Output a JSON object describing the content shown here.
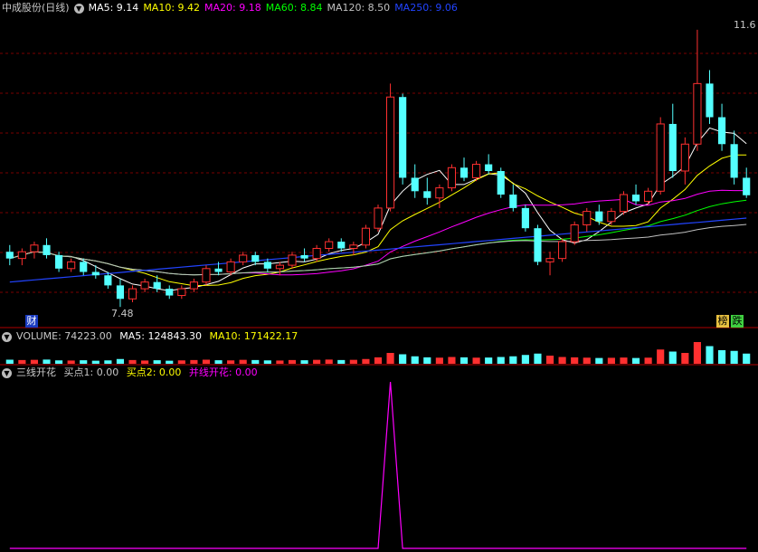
{
  "price_panel": {
    "title": "中成股份(日线)",
    "ma_labels": [
      {
        "name": "MA5",
        "value": "9.14",
        "color": "#ffffff"
      },
      {
        "name": "MA10",
        "value": "9.42",
        "color": "#ffff00"
      },
      {
        "name": "MA20",
        "value": "9.18",
        "color": "#ff00ff"
      },
      {
        "name": "MA60",
        "value": "8.84",
        "color": "#00ff00"
      },
      {
        "name": "MA120",
        "value": "8.50",
        "color": "#c0c0c0"
      },
      {
        "name": "MA250",
        "value": "9.06",
        "color": "#2244ff"
      }
    ],
    "high_label": "11.6",
    "low_label": "7.48",
    "badge_cai": "财",
    "badge_bang": "榜",
    "badge_die": "跌"
  },
  "volume_panel": {
    "title": "VOLUME",
    "value": "74223.00",
    "ma5_label": "MA5",
    "ma5_value": "124843.30",
    "ma10_label": "MA10",
    "ma10_value": "171422.17"
  },
  "indicator_panel": {
    "title": "三线开花",
    "buy1_label": "买点1",
    "buy1_value": "0.00",
    "buy2_label": "买点2",
    "buy2_value": "0.00",
    "bingxian_label": "并线开花",
    "bingxian_value": "0.00"
  },
  "colors": {
    "up": "#ff3030",
    "down": "#54ffff",
    "ma5": "#ffffff",
    "ma10": "#ffff00",
    "ma20": "#ff00ff",
    "ma60": "#00ff00",
    "ma120": "#c0c0c0",
    "ma250": "#2244ff",
    "grid": "#7a0000",
    "separator": "#b00000"
  },
  "chart_data": [
    {
      "type": "candlestick",
      "title": "中成股份(日线)",
      "ylim": [
        7.2,
        11.8
      ],
      "candles": [
        [
          8.3,
          8.4,
          8.1,
          8.2
        ],
        [
          8.2,
          8.35,
          8.1,
          8.3
        ],
        [
          8.3,
          8.45,
          8.2,
          8.4
        ],
        [
          8.4,
          8.5,
          8.2,
          8.25
        ],
        [
          8.25,
          8.3,
          8.0,
          8.05
        ],
        [
          8.05,
          8.2,
          8.0,
          8.15
        ],
        [
          8.15,
          8.2,
          7.95,
          8.0
        ],
        [
          8.0,
          8.1,
          7.9,
          7.95
        ],
        [
          7.95,
          8.0,
          7.75,
          7.8
        ],
        [
          7.8,
          7.9,
          7.48,
          7.6
        ],
        [
          7.6,
          7.8,
          7.55,
          7.75
        ],
        [
          7.75,
          7.9,
          7.7,
          7.85
        ],
        [
          7.85,
          7.95,
          7.7,
          7.75
        ],
        [
          7.75,
          7.8,
          7.6,
          7.65
        ],
        [
          7.65,
          7.8,
          7.6,
          7.75
        ],
        [
          7.75,
          7.9,
          7.7,
          7.85
        ],
        [
          7.85,
          8.1,
          7.8,
          8.05
        ],
        [
          8.05,
          8.15,
          7.95,
          8.0
        ],
        [
          8.0,
          8.2,
          7.95,
          8.15
        ],
        [
          8.15,
          8.3,
          8.1,
          8.25
        ],
        [
          8.25,
          8.3,
          8.1,
          8.15
        ],
        [
          8.15,
          8.2,
          8.0,
          8.05
        ],
        [
          8.05,
          8.15,
          7.95,
          8.1
        ],
        [
          8.1,
          8.3,
          8.05,
          8.25
        ],
        [
          8.25,
          8.35,
          8.15,
          8.2
        ],
        [
          8.2,
          8.4,
          8.15,
          8.35
        ],
        [
          8.35,
          8.5,
          8.3,
          8.45
        ],
        [
          8.45,
          8.5,
          8.3,
          8.35
        ],
        [
          8.35,
          8.45,
          8.25,
          8.4
        ],
        [
          8.4,
          8.7,
          8.35,
          8.65
        ],
        [
          8.65,
          9.0,
          8.6,
          8.95
        ],
        [
          8.95,
          10.8,
          8.9,
          10.6
        ],
        [
          10.6,
          10.65,
          9.3,
          9.4
        ],
        [
          9.4,
          9.6,
          9.1,
          9.2
        ],
        [
          9.2,
          9.4,
          9.0,
          9.1
        ],
        [
          9.1,
          9.3,
          8.95,
          9.25
        ],
        [
          9.25,
          9.6,
          9.2,
          9.55
        ],
        [
          9.55,
          9.7,
          9.35,
          9.4
        ],
        [
          9.4,
          9.65,
          9.35,
          9.6
        ],
        [
          9.6,
          9.75,
          9.45,
          9.5
        ],
        [
          9.5,
          9.55,
          9.1,
          9.15
        ],
        [
          9.15,
          9.3,
          8.9,
          8.95
        ],
        [
          8.95,
          9.0,
          8.6,
          8.65
        ],
        [
          8.65,
          8.7,
          8.1,
          8.15
        ],
        [
          8.15,
          8.3,
          7.95,
          8.2
        ],
        [
          8.2,
          8.5,
          8.15,
          8.45
        ],
        [
          8.45,
          8.75,
          8.4,
          8.7
        ],
        [
          8.7,
          8.95,
          8.6,
          8.9
        ],
        [
          8.9,
          9.0,
          8.7,
          8.75
        ],
        [
          8.75,
          8.95,
          8.7,
          8.9
        ],
        [
          8.9,
          9.2,
          8.85,
          9.15
        ],
        [
          9.15,
          9.3,
          9.0,
          9.05
        ],
        [
          9.05,
          9.25,
          9.0,
          9.2
        ],
        [
          9.2,
          10.3,
          9.15,
          10.2
        ],
        [
          10.2,
          10.5,
          9.4,
          9.5
        ],
        [
          9.5,
          10.0,
          9.3,
          9.9
        ],
        [
          9.9,
          11.6,
          9.8,
          10.8
        ],
        [
          10.8,
          11.0,
          10.2,
          10.3
        ],
        [
          10.3,
          10.5,
          9.8,
          9.9
        ],
        [
          9.9,
          10.1,
          9.3,
          9.4
        ],
        [
          9.4,
          9.55,
          9.1,
          9.14
        ]
      ],
      "ma_series": [
        {
          "name": "MA5",
          "last": 9.14
        },
        {
          "name": "MA10",
          "last": 9.42
        },
        {
          "name": "MA20",
          "last": 9.18
        },
        {
          "name": "MA60",
          "last": 8.84
        },
        {
          "name": "MA120",
          "last": 8.5
        },
        {
          "name": "MA250",
          "last": 9.06
        }
      ]
    },
    {
      "type": "bar",
      "title": "VOLUME",
      "values": [
        60,
        55,
        58,
        62,
        50,
        48,
        52,
        45,
        50,
        70,
        55,
        48,
        52,
        45,
        50,
        55,
        60,
        52,
        50,
        58,
        55,
        50,
        48,
        55,
        52,
        58,
        62,
        55,
        58,
        70,
        95,
        160,
        140,
        110,
        95,
        90,
        100,
        95,
        90,
        92,
        100,
        110,
        130,
        150,
        120,
        100,
        95,
        90,
        85,
        88,
        92,
        85,
        90,
        210,
        180,
        160,
        320,
        260,
        200,
        190,
        150
      ]
    },
    {
      "type": "line",
      "title": "三线开花",
      "x": [
        0,
        30,
        31,
        32,
        60
      ],
      "values": [
        0,
        0,
        1,
        0,
        0
      ]
    }
  ]
}
